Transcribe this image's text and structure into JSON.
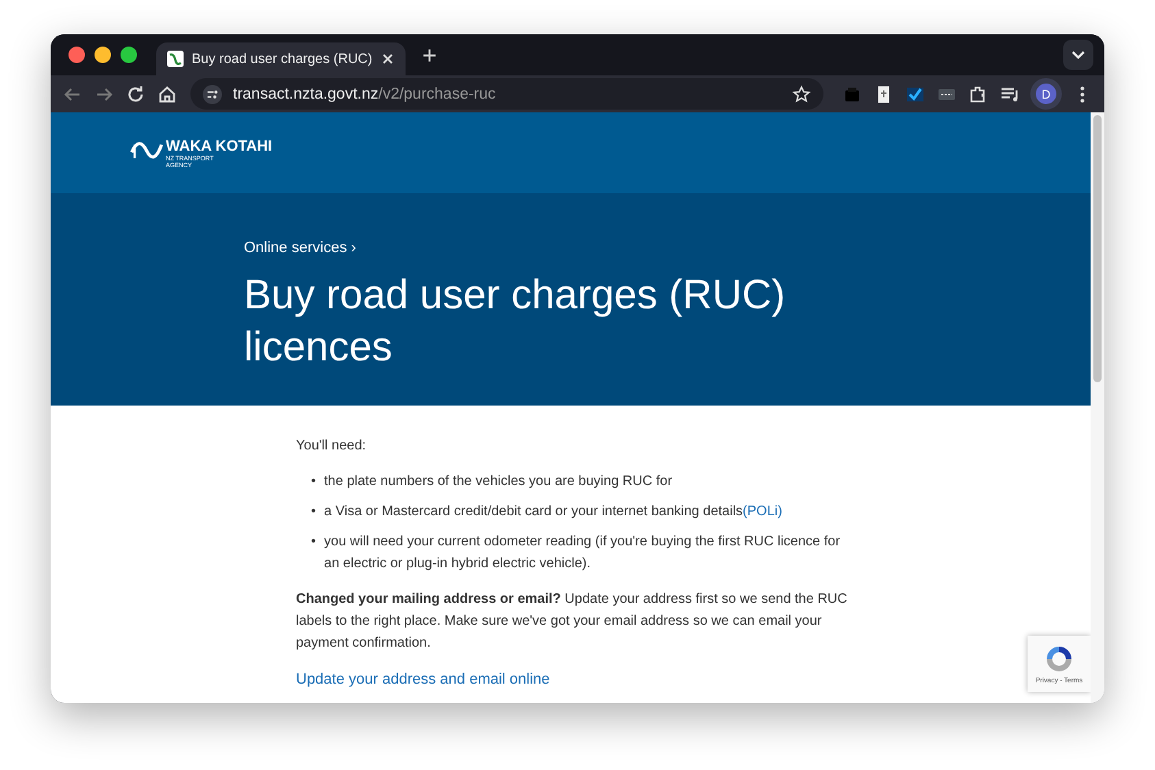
{
  "browser": {
    "tabs": [
      {
        "title": "Buy road user charges (RUC)",
        "selected": true
      }
    ],
    "url_host": "transact.nzta.govt.nz",
    "url_path": "/v2/purchase-ruc",
    "profile_initial": "D"
  },
  "header": {
    "logo_name": "WAKA KOTAHI",
    "logo_sub": [
      "NZ TRANSPORT",
      "AGENCY"
    ]
  },
  "hero": {
    "breadcrumb": "Online services",
    "breadcrumb_sep": "›",
    "title": "Buy road user charges (RUC) licences"
  },
  "content": {
    "intro": "You'll need:",
    "bullets": [
      {
        "marker": "•",
        "text": "the plate numbers of the vehicles you are buying RUC for"
      },
      {
        "marker": "•",
        "text": "a Visa or Mastercard credit/debit card or your internet banking details",
        "link": "(POLi)"
      },
      {
        "marker": "•",
        "text": "you will need your current odometer reading (if you're buying the first RUC licence for an electric or plug-in hybrid electric vehicle)."
      }
    ],
    "notice": "**Changed your mailing address or email?** Update your address first so we send the RUC labels to the right place. Make sure we've got your email address so we can email your payment confirmation.",
    "link": "Update your address and email online"
  },
  "recaptcha": {
    "label": "Privacy - Terms"
  }
}
